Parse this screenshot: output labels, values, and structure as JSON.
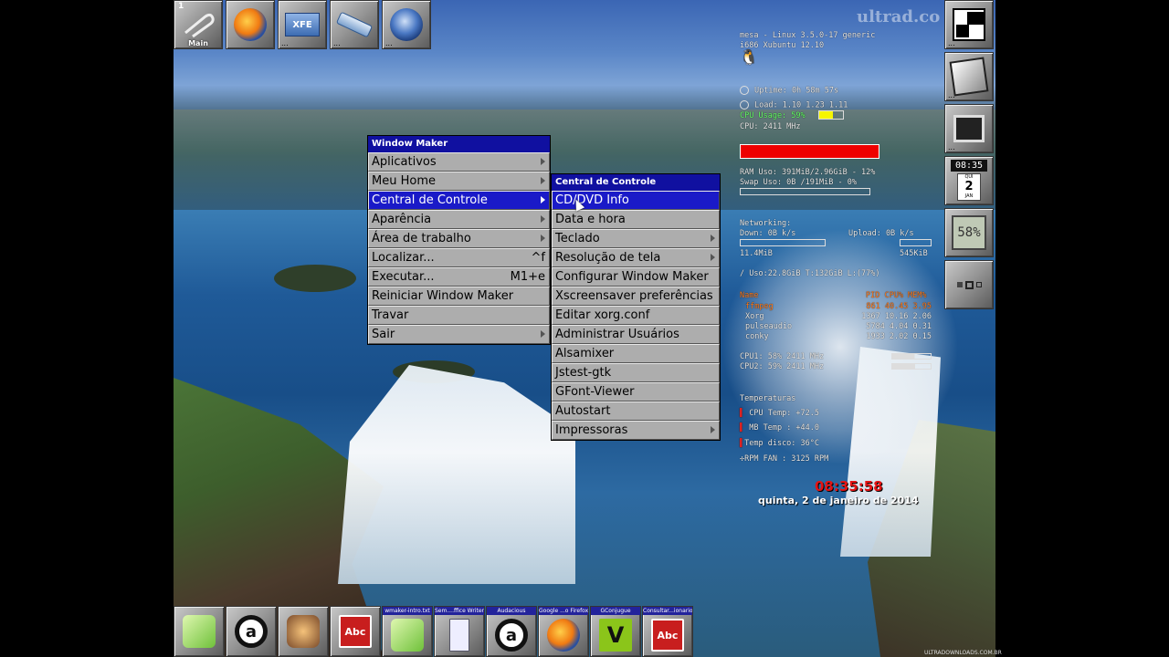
{
  "top_dock": {
    "clip": {
      "number": "1",
      "label": "Main"
    },
    "tiles": [
      {
        "name": "firefox",
        "icon": "firefox-icon"
      },
      {
        "name": "xfe",
        "icon": "xfe-file-manager-icon",
        "label": "XFE",
        "dots": "..."
      },
      {
        "name": "usb",
        "icon": "usb-drive-icon",
        "dots": "..."
      },
      {
        "name": "thunderbird",
        "icon": "thunderbird-icon",
        "dots": "..."
      }
    ]
  },
  "right_dock": {
    "clock_time": "08:35",
    "calendar_day": "2",
    "calendar_weekday": "QUI",
    "calendar_month": "JAN",
    "cpu_meter": "58%"
  },
  "root_menu": {
    "title": "Window Maker",
    "items": [
      {
        "label": "Aplicativos",
        "submenu": true
      },
      {
        "label": "Meu Home",
        "submenu": true
      },
      {
        "label": "Central de Controle",
        "submenu": true,
        "active": true
      },
      {
        "label": "Aparência",
        "submenu": true
      },
      {
        "label": "Área de trabalho",
        "submenu": true
      },
      {
        "label": "Localizar...",
        "shortcut": "^f"
      },
      {
        "label": "Executar...",
        "shortcut": "M1+e"
      },
      {
        "label": "Reiniciar Window Maker"
      },
      {
        "label": "Travar"
      },
      {
        "label": "Sair",
        "submenu": true
      }
    ]
  },
  "sub_menu": {
    "title": "Central de Controle",
    "items": [
      {
        "label": "CD/DVD Info",
        "active": true
      },
      {
        "label": "Data e hora"
      },
      {
        "label": "Teclado",
        "submenu": true
      },
      {
        "label": "Resolução de tela",
        "submenu": true
      },
      {
        "label": "Configurar Window Maker"
      },
      {
        "label": "Xscreensaver preferências"
      },
      {
        "label": "Editar xorg.conf"
      },
      {
        "label": "Administrar Usuários"
      },
      {
        "label": "Alsamixer"
      },
      {
        "label": "Jstest-gtk"
      },
      {
        "label": "GFont-Viewer"
      },
      {
        "label": "Autostart"
      },
      {
        "label": "Impressoras",
        "submenu": true
      }
    ]
  },
  "conky": {
    "host": "mesa - Linux 3.5.0-17 generic",
    "distro": "i686 Xubuntu 12.10",
    "uptime": "Uptime: 0h 58m 57s",
    "load": "Load: 1.10 1.23 1.11",
    "cpu_usage": "CPU Usage: 59%",
    "cpu_usage_fraction": 0.59,
    "cpu_freq": "CPU: 2411 MHz",
    "ram": "RAM Uso: 391MiB/2.96GiB - 12%",
    "swap": "Swap Uso: 0B /191MiB - 0%",
    "net_header": "Networking:",
    "down": "Down: 0B   k/s",
    "up": "Upload: 0B   k/s",
    "down_total": "11.4MiB",
    "up_total": "545KiB",
    "disk": "/ Uso:22.8GiB T:132GiB L:(77%)",
    "proc_header": {
      "name": "Name",
      "cols": "PID CPU% MEM%"
    },
    "procs": [
      {
        "name": "ffmpeg",
        "vals": "861  40.45  3.95"
      },
      {
        "name": "Xorg",
        "vals": "1367  10.16  2.06"
      },
      {
        "name": "pulseaudio",
        "vals": "5784  4.04  0.31"
      },
      {
        "name": "conky",
        "vals": "1933  2.02  0.15"
      }
    ],
    "cpu1": "CPU1: 58% 2411 MHz",
    "cpu2": "CPU2: 59% 2411 MHz",
    "temps_header": "Temperaturas",
    "cpu_temp": "CPU Temp:  +72.5",
    "mb_temp": "MB Temp :  +44.0",
    "disk_temp": "Temp disco: 36°C",
    "fan": "RPM FAN :  3125 RPM",
    "clock": "08:35:58",
    "date": "quinta, 2 de janeiro de 2014"
  },
  "watermark": "ultrad.co",
  "footer_mark": "ULTRADOWNLOADS.COM.BR",
  "bottom_dock": {
    "appicons": [
      {
        "icon": "leafpad-icon"
      },
      {
        "icon": "audacious-icon"
      },
      {
        "icon": "gimp-icon"
      },
      {
        "icon": "dictionary-icon"
      }
    ],
    "mini_windows": [
      {
        "caption": "wmaker-intro.txt",
        "icon": "leafpad-icon"
      },
      {
        "caption": "Sem....ffice Writer",
        "icon": "writer-doc-icon"
      },
      {
        "caption": "Audacious",
        "icon": "audacious-icon"
      },
      {
        "caption": "Google ...o Firefox",
        "icon": "firefox-icon"
      },
      {
        "caption": "GConjugue",
        "icon": "gconjugue-icon"
      },
      {
        "caption": "Consultar...ionario",
        "icon": "dictionary-icon"
      }
    ]
  },
  "colors": {
    "menu_title_bg": "#1010a0",
    "menu_active_bg": "#1a1ac8",
    "clock_red": "#e51414"
  }
}
